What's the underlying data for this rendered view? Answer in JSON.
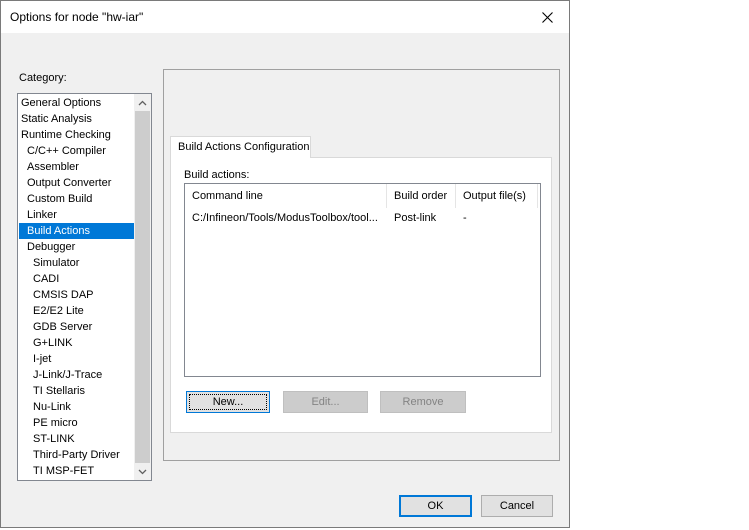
{
  "window": {
    "title": "Options for node \"hw-iar\""
  },
  "category": {
    "label": "Category:",
    "items": [
      "General Options",
      "Static Analysis",
      "Runtime Checking",
      "C/C++ Compiler",
      "Assembler",
      "Output Converter",
      "Custom Build",
      "Linker",
      "Build Actions",
      "Debugger",
      "Simulator",
      "CADI",
      "CMSIS DAP",
      "E2/E2 Lite",
      "GDB Server",
      "G+LINK",
      "I-jet",
      "J-Link/J-Trace",
      "TI Stellaris",
      "Nu-Link",
      "PE micro",
      "ST-LINK",
      "Third-Party Driver",
      "TI MSP-FET"
    ],
    "selected": "Build Actions"
  },
  "tab": {
    "label": "Build Actions Configuration"
  },
  "build_actions": {
    "label": "Build actions:",
    "columns": [
      "Command line",
      "Build order",
      "Output file(s)"
    ],
    "rows": [
      {
        "command": "C:/Infineon/Tools/ModusToolbox/tool...",
        "order": "Post-link",
        "output": "-"
      }
    ]
  },
  "buttons": {
    "new": "New...",
    "edit": "Edit...",
    "remove": "Remove",
    "ok": "OK",
    "cancel": "Cancel"
  },
  "icons": {
    "close": "close-icon",
    "scroll_up": "chevron-up-icon",
    "scroll_down": "chevron-down-icon"
  }
}
